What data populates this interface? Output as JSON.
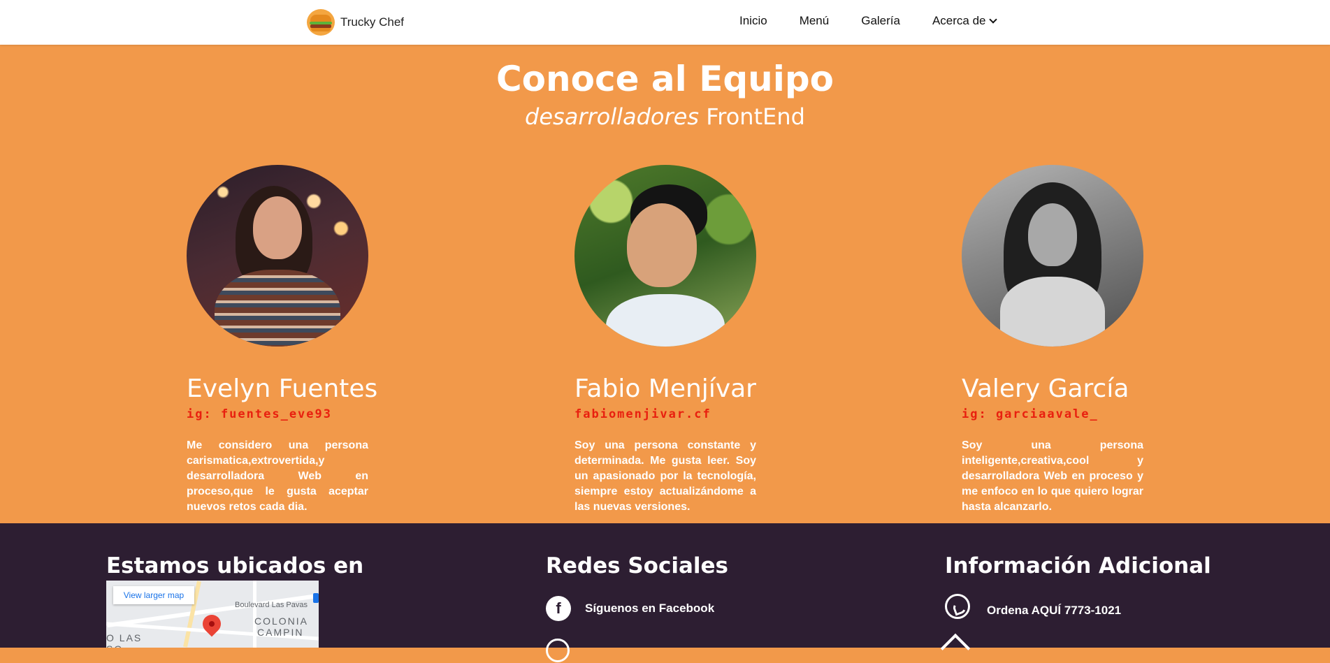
{
  "nav": {
    "brand": "Trucky Chef",
    "links": [
      "Inicio",
      "Menú",
      "Galería",
      "Acerca de"
    ]
  },
  "hero": {
    "title": "Conoce al Equipo",
    "subtitle_italic": "desarrolladores",
    "subtitle_rest": " FrontEnd"
  },
  "team": [
    {
      "name": "Evelyn Fuentes",
      "ig": "ig: fuentes_eve93",
      "desc": "Me considero una persona carismatica,extrovertida,y desarrolladora Web en proceso,que le gusta aceptar nuevos retos cada dia."
    },
    {
      "name": "Fabio Menjívar",
      "ig": "fabiomenjivar.cf",
      "desc": "Soy una persona constante y determinada. Me gusta leer. Soy un apasionado por la tecnología, siempre estoy actualizándome a las nuevas versiones."
    },
    {
      "name": "Valery García",
      "ig": "ig: garciaavale_",
      "desc": "Soy una persona inteligente,creativa,cool y desarrolladora Web en proceso y me enfoco en lo que quiero lograr hasta alcanzarlo."
    }
  ],
  "footer": {
    "location_title": "Estamos ubicados en",
    "map": {
      "button": "View larger map",
      "street": "Boulevard Las Pavas",
      "area1": "COLONIA",
      "area2": "CAMPIN",
      "area3": "O LAS",
      "area4": "SO"
    },
    "social_title": "Redes Sociales",
    "facebook": "Síguenos en Facebook",
    "facebook_glyph": "f",
    "info_title": "Información Adicional",
    "order": "Ordena AQUÍ 7773-1021"
  },
  "colors": {
    "accent": "#f2994a",
    "footer_bg": "#2d1e32",
    "handle_red": "#e8200f"
  }
}
